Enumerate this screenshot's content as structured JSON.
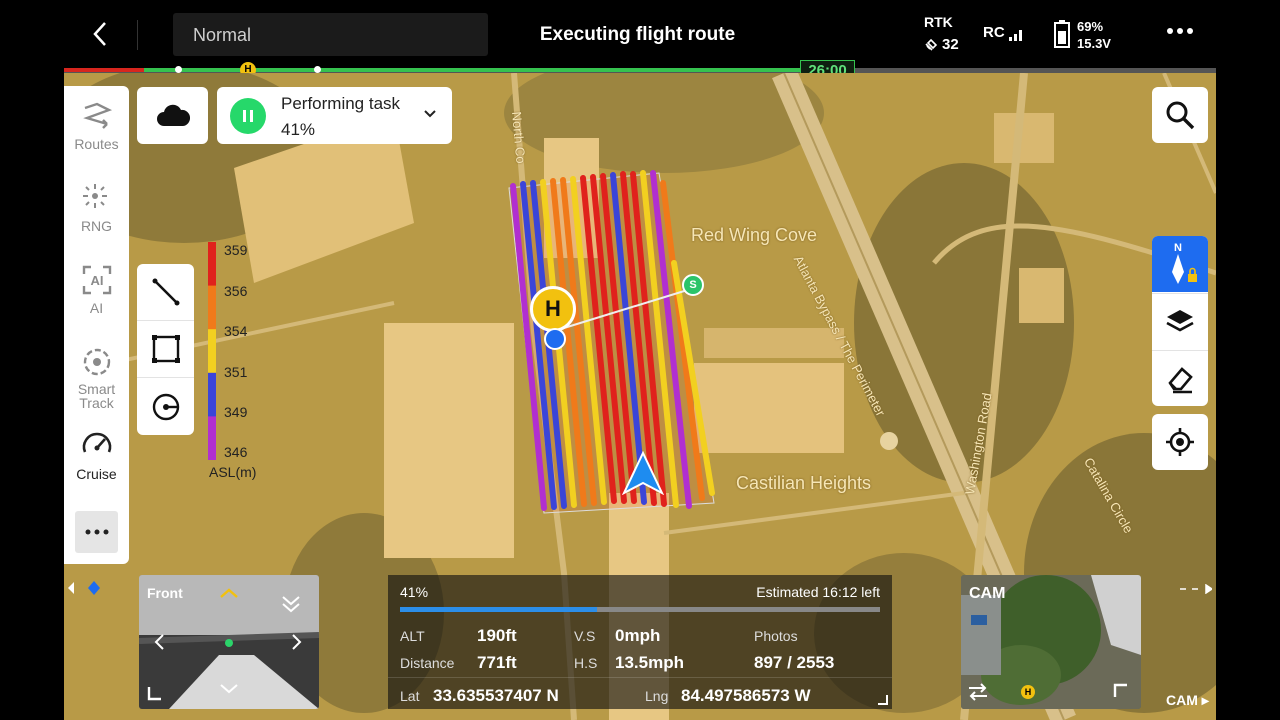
{
  "topbar": {
    "mode": "Normal",
    "title": "Executing flight route",
    "rtk_label": "RTK",
    "rtk_count": "32",
    "rc_label": "RC",
    "battery_percent": "69%",
    "battery_voltage": "15.3V"
  },
  "route": {
    "home_marker": "H",
    "timer": "26:00",
    "progress_fraction": 0.64
  },
  "tools": [
    {
      "label": "Routes",
      "icon": "routes-icon"
    },
    {
      "label": "RNG",
      "icon": "rng-icon"
    },
    {
      "label": "AI",
      "icon": "ai-icon"
    },
    {
      "label": "Smart Track",
      "icon": "smart-track-icon"
    },
    {
      "label": "Cruise",
      "icon": "cruise-icon"
    }
  ],
  "task": {
    "label": "Performing task",
    "percent": "41%"
  },
  "legend": {
    "values": [
      "359",
      "356",
      "354",
      "351",
      "349",
      "346"
    ],
    "unit": "ASL(m)",
    "colors": [
      "#e0221c",
      "#f07a1a",
      "#f2d020",
      "#3b45d8",
      "#b12fd0"
    ]
  },
  "map": {
    "labels": {
      "red_wing_cove": "Red Wing Cove",
      "castilian_heights": "Castilian Heights",
      "atlanta_bypass": "Atlanta Bypass / The Perimeter",
      "washington_road": "Washington Road",
      "catalina_circle": "Catalina Circle",
      "north_co": "North Co"
    },
    "home_marker": "H",
    "start_marker": "S",
    "compass_letter": "N"
  },
  "telemetry": {
    "progress_label": "41%",
    "progress_fraction": 0.41,
    "estimated_left": "Estimated 16:12 left",
    "alt_label": "ALT",
    "alt_value": "190ft",
    "vs_label": "V.S",
    "vs_value": "0mph",
    "photos_label": "Photos",
    "photos_value": "897 / 2553",
    "distance_label": "Distance",
    "distance_value": "771ft",
    "hs_label": "H.S",
    "hs_value": "13.5mph",
    "lat_label": "Lat",
    "lat_value": "33.635537407 N",
    "lng_label": "Lng",
    "lng_value": "84.497586573 W"
  },
  "cameras": {
    "front_label": "Front",
    "cam_label": "CAM",
    "cam_corner_label": "CAM",
    "cam_home_marker": "H"
  }
}
